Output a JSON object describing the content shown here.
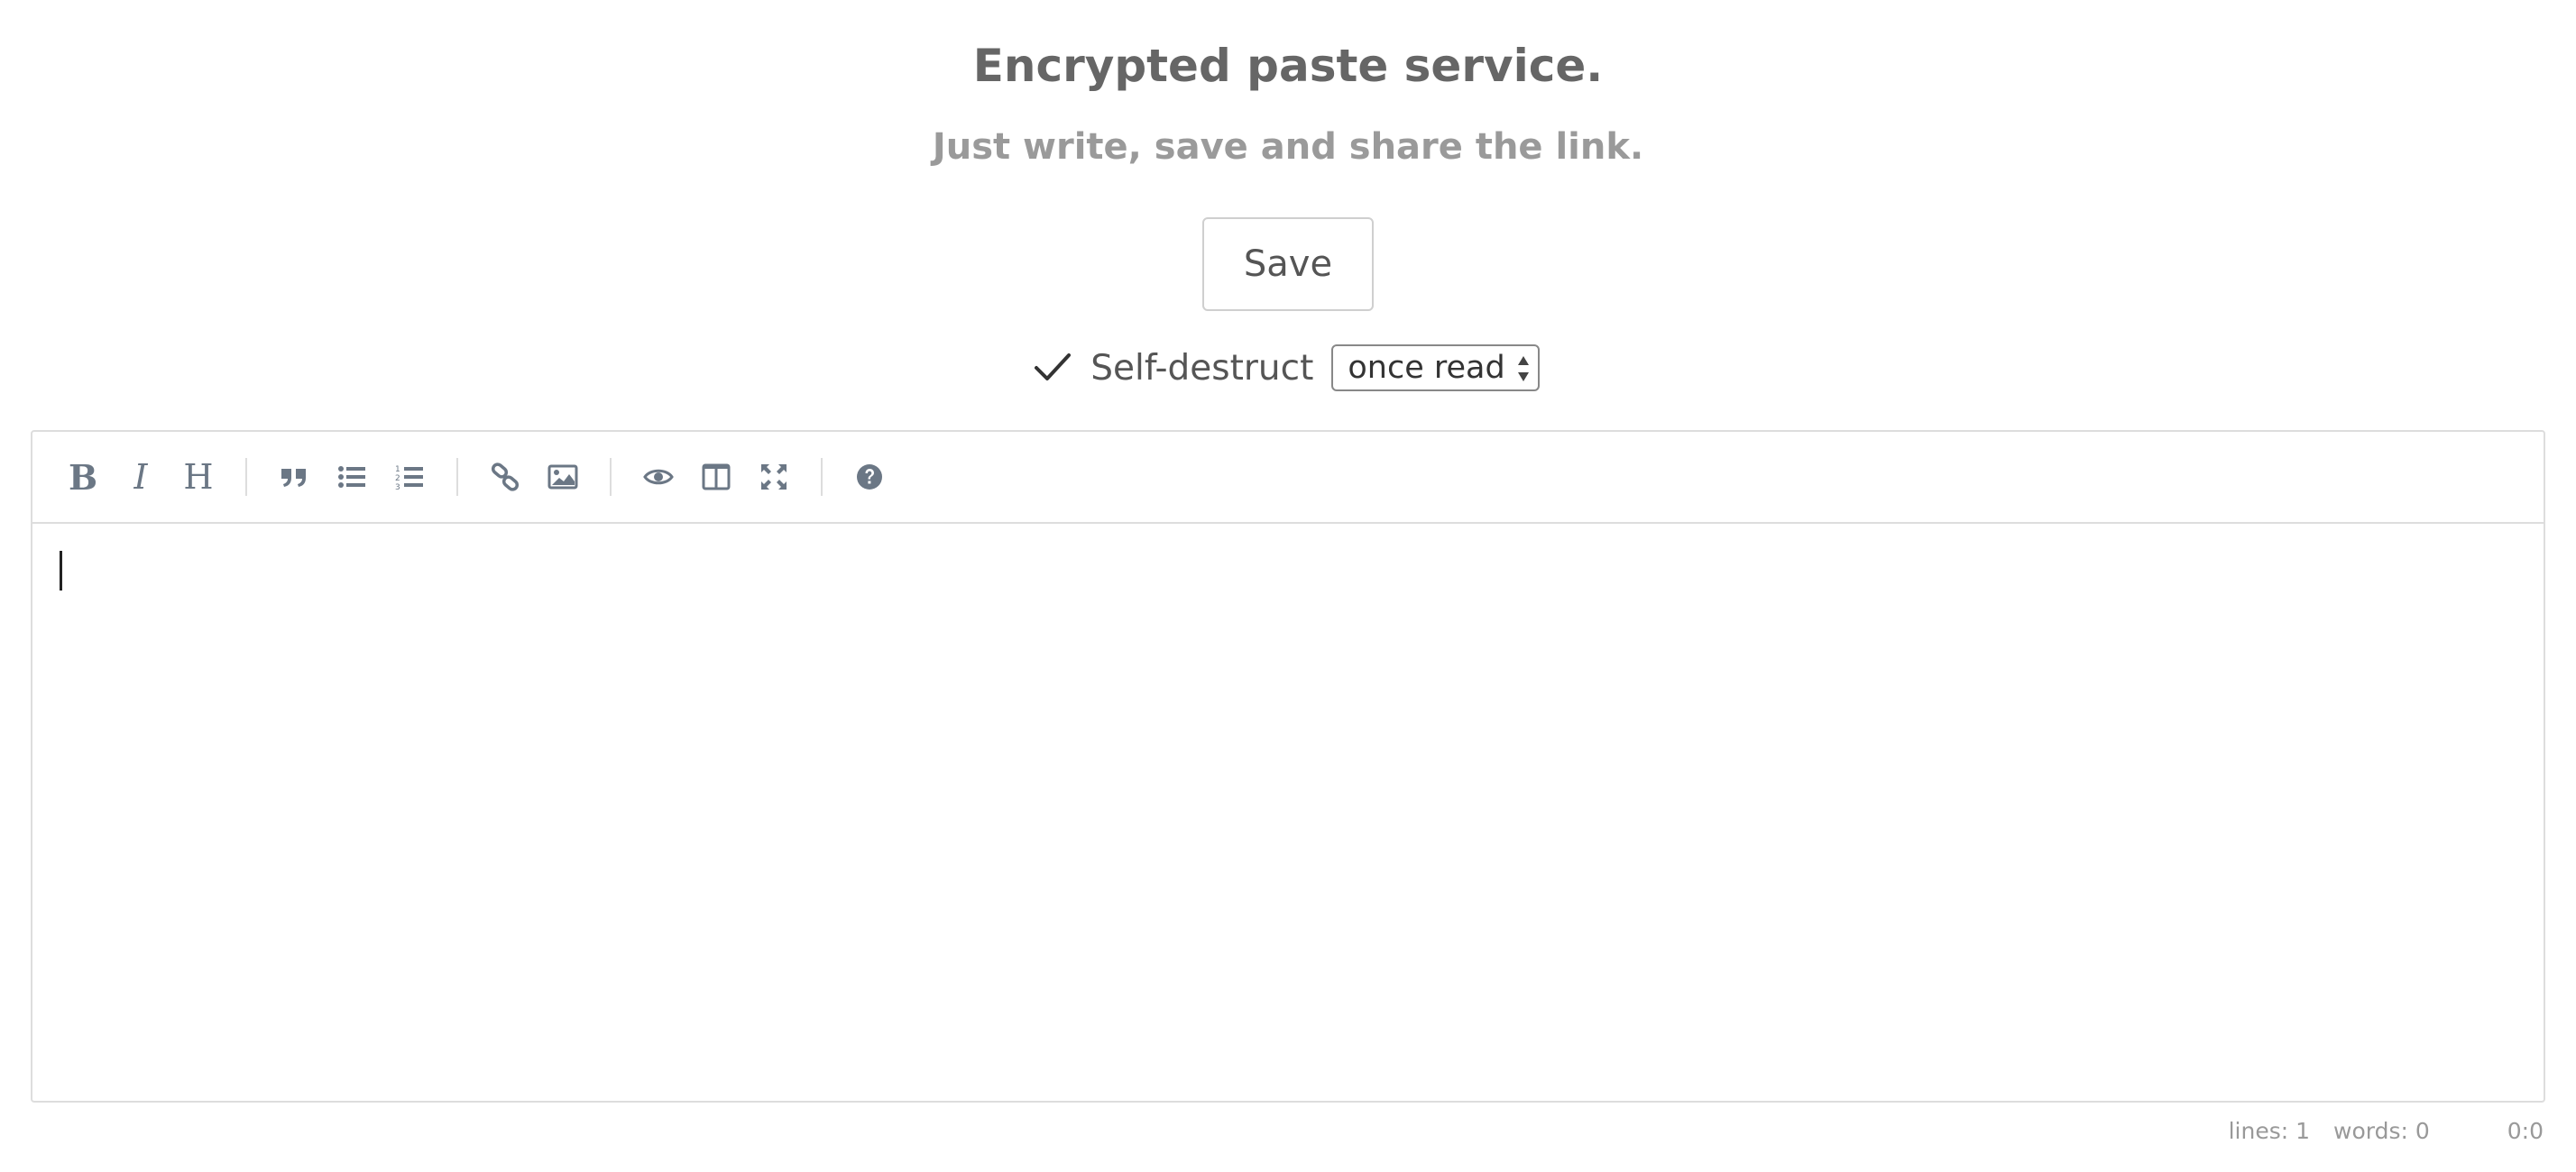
{
  "header": {
    "title": "Encrypted paste service.",
    "subtitle": "Just write, save and share the link."
  },
  "actions": {
    "save_label": "Save"
  },
  "self_destruct": {
    "checked": true,
    "label": "Self-destruct",
    "selected_option": "once read"
  },
  "toolbar": {
    "buttons": [
      {
        "name": "bold",
        "glyph": "B"
      },
      {
        "name": "italic",
        "glyph": "I"
      },
      {
        "name": "heading",
        "glyph": "H"
      },
      {
        "name": "quote",
        "icon": "quote-icon"
      },
      {
        "name": "unordered-list",
        "icon": "list-ul-icon"
      },
      {
        "name": "ordered-list",
        "icon": "list-ol-icon"
      },
      {
        "name": "link",
        "icon": "link-icon"
      },
      {
        "name": "image",
        "icon": "image-icon"
      },
      {
        "name": "preview",
        "icon": "eye-icon"
      },
      {
        "name": "side-by-side",
        "icon": "columns-icon"
      },
      {
        "name": "fullscreen",
        "icon": "arrows-alt-icon"
      },
      {
        "name": "guide",
        "icon": "question-circle-icon"
      }
    ]
  },
  "editor": {
    "content": ""
  },
  "status": {
    "lines": "lines: 1",
    "words": "words: 0",
    "cursor": "0:0"
  },
  "colors": {
    "icon": "#6b7785",
    "border": "#dddddd",
    "title": "#666666",
    "subtitle": "#9a9a9a"
  }
}
